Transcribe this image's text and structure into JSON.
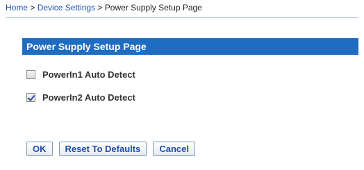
{
  "breadcrumb": {
    "home": "Home",
    "sep1": " > ",
    "device_settings": "Device Settings",
    "sep2": " > ",
    "current": "Power Supply Setup Page"
  },
  "section": {
    "title": "Power Supply Setup Page"
  },
  "options": [
    {
      "label": "PowerIn1 Auto Detect",
      "checked": false
    },
    {
      "label": "PowerIn2 Auto Detect",
      "checked": true
    }
  ],
  "buttons": {
    "ok": "OK",
    "reset": "Reset To Defaults",
    "cancel": "Cancel"
  }
}
